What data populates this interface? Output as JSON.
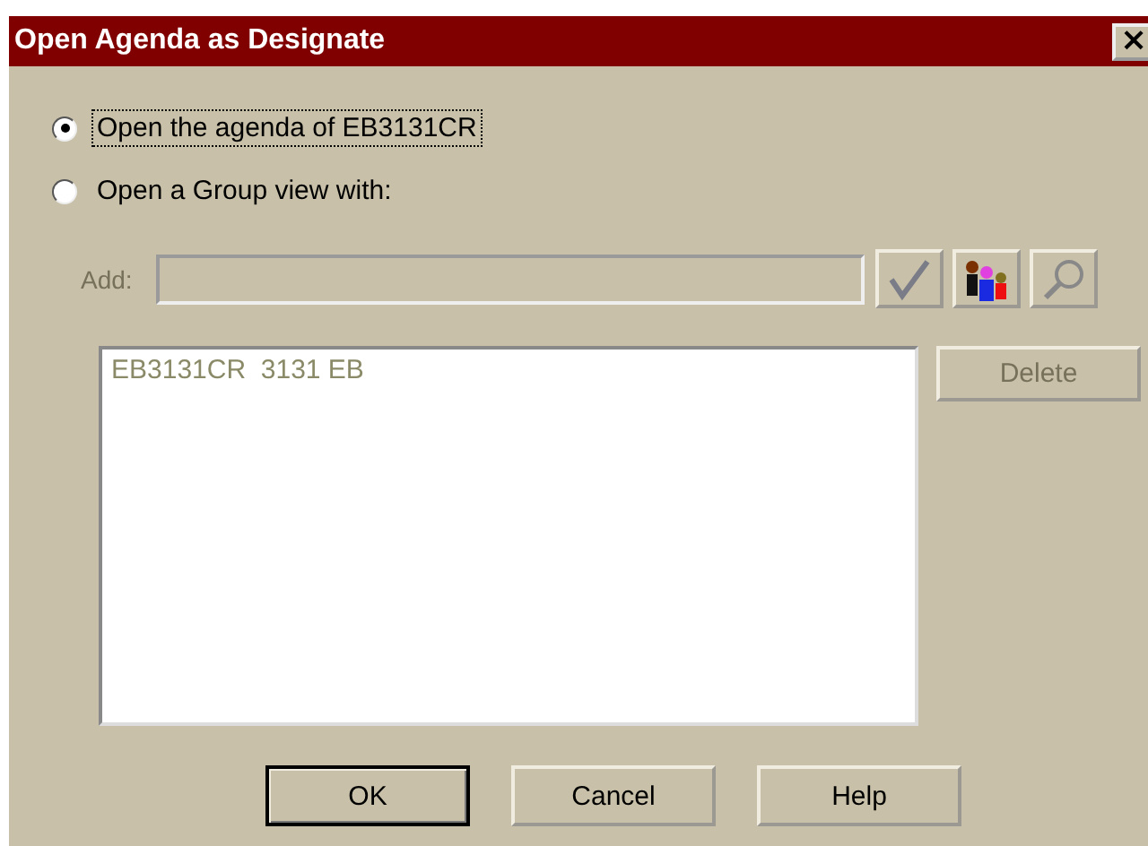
{
  "window": {
    "title": "Open Agenda as Designate",
    "close": "×"
  },
  "options": [
    {
      "label": "Open the agenda of EB3131CR",
      "selected": true,
      "focused": true
    },
    {
      "label": "Open a Group view with:",
      "selected": false,
      "focused": false
    }
  ],
  "add": {
    "label": "Add:",
    "disabled": true
  },
  "list": {
    "items": [
      {
        "text": "EB3131CR  3131 EB"
      }
    ],
    "disabled": true
  },
  "delete": {
    "label": "Delete",
    "disabled": true
  },
  "buttons": [
    {
      "label": "OK",
      "default": true
    },
    {
      "label": "Cancel",
      "default": false
    },
    {
      "label": "Help",
      "default": false
    }
  ]
}
